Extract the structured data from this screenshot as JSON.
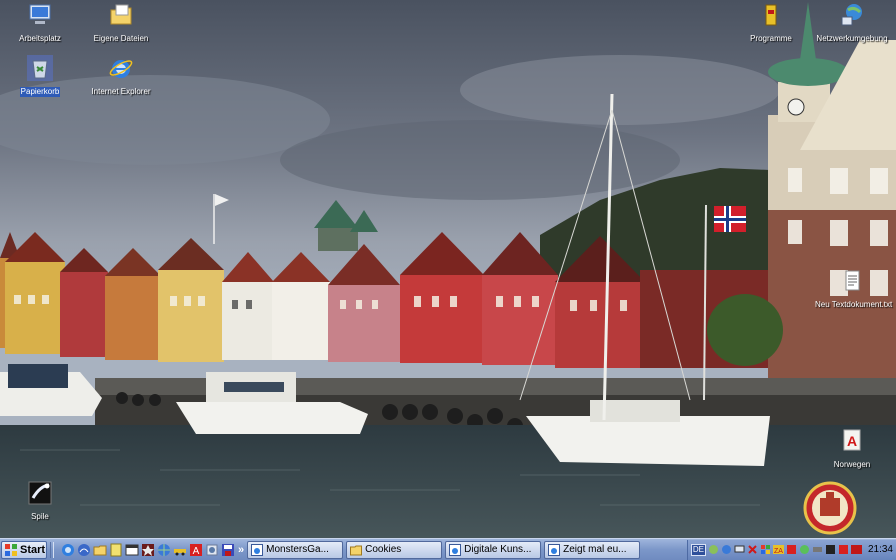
{
  "desktop": {
    "icons": [
      {
        "label": "Arbeitsplatz",
        "icon": "my-computer-icon"
      },
      {
        "label": "Eigene Dateien",
        "icon": "my-documents-icon"
      },
      {
        "label": "Papierkorb",
        "icon": "recycle-bin-icon"
      },
      {
        "label": "Internet Explorer",
        "icon": "internet-explorer-icon"
      },
      {
        "label": "Programme",
        "icon": "programs-folder-icon"
      },
      {
        "label": "Netzwerkumgebung",
        "icon": "network-places-icon"
      },
      {
        "label": "Neu Textdokument.txt",
        "icon": "text-document-icon"
      },
      {
        "label": "Norwegen",
        "icon": "acrobat-document-icon"
      },
      {
        "label": "Spile",
        "icon": "game-icon"
      }
    ],
    "flag_colors": {
      "red": "#d21f2b",
      "blue": "#1b3b8a",
      "white": "#ffffff"
    }
  },
  "taskbar": {
    "start_label": "Start",
    "quick_launch": [
      "ie-icon",
      "show-desktop-icon",
      "folder-icon",
      "notepad-icon",
      "window-icon",
      "media-icon",
      "browser-icon",
      "car-icon",
      "acrobat-icon",
      "app-icon",
      "save-icon"
    ],
    "tasks": [
      {
        "label": "MonstersGa...",
        "icon": "ie-window-icon"
      },
      {
        "label": "Cookies",
        "icon": "folder-icon"
      },
      {
        "label": "Digitale Kuns...",
        "icon": "ie-window-icon"
      },
      {
        "label": "Zeigt mal eu...",
        "icon": "ie-window-icon"
      }
    ],
    "tray": {
      "language": "DE",
      "clock": "21:34"
    }
  }
}
